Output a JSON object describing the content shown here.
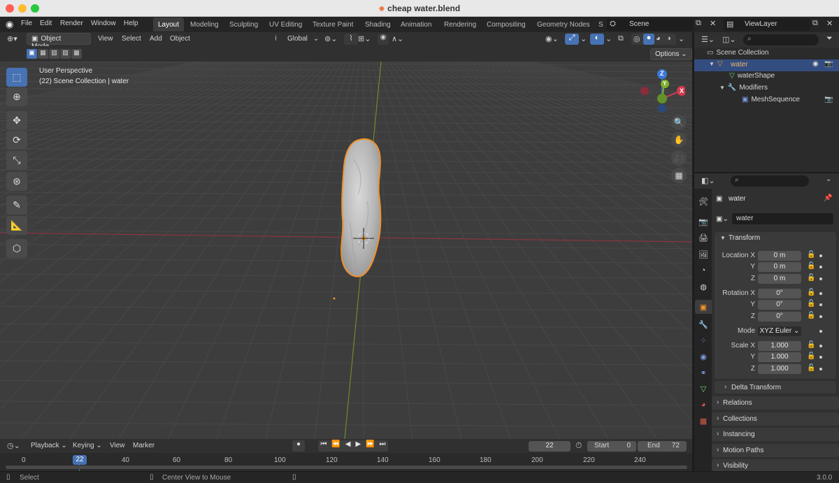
{
  "window": {
    "title": "cheap water.blend",
    "file_icon": "blend-file-icon"
  },
  "menu": [
    "File",
    "Edit",
    "Render",
    "Window",
    "Help"
  ],
  "workspaces": [
    "Layout",
    "Modeling",
    "Sculpting",
    "UV Editing",
    "Texture Paint",
    "Shading",
    "Animation",
    "Rendering",
    "Compositing",
    "Geometry Nodes",
    "S"
  ],
  "active_workspace": "Layout",
  "scene": {
    "label": "Scene",
    "viewlayer": "ViewLayer"
  },
  "viewport_header": {
    "mode": "Object Mode",
    "menus": [
      "View",
      "Select",
      "Add",
      "Object"
    ],
    "orientation": "Global",
    "options_label": "Options"
  },
  "viewport": {
    "overlay_title": "User Perspective",
    "overlay_sub": "(22) Scene Collection | water",
    "gizmo_axes": {
      "z": "Z",
      "y": "Y",
      "x": "X"
    },
    "colors": {
      "x_axis": "#c03a4a",
      "y_axis": "#84b92d",
      "selection": "#f0922c"
    }
  },
  "outliner": {
    "scene_collection": "Scene Collection",
    "items": [
      {
        "label": "water",
        "indent": 1
      },
      {
        "label": "waterShape",
        "indent": 2
      },
      {
        "label": "Modifiers",
        "indent": 2
      },
      {
        "label": "MeshSequence",
        "indent": 3
      }
    ]
  },
  "properties": {
    "object_name": "water",
    "data_name": "water",
    "transform_label": "Transform",
    "location": {
      "label": "Location X",
      "x": "0 m",
      "y": "0 m",
      "z": "0 m"
    },
    "rotation": {
      "label": "Rotation X",
      "x": "0°",
      "y": "0°",
      "z": "0°"
    },
    "mode": {
      "label": "Mode",
      "value": "XYZ Euler"
    },
    "scale": {
      "label": "Scale X",
      "x": "1.000",
      "y": "1.000",
      "z": "1.000"
    },
    "axis_y": "Y",
    "axis_z": "Z",
    "subpanels": [
      "Delta Transform",
      "Relations",
      "Collections",
      "Instancing",
      "Motion Paths",
      "Visibility"
    ]
  },
  "timeline": {
    "menus": [
      "Playback",
      "Keying",
      "View",
      "Marker"
    ],
    "current_frame": "22",
    "start_label": "Start",
    "start": "0",
    "end_label": "End",
    "end": "72",
    "ruler": [
      "0",
      "22",
      "40",
      "60",
      "80",
      "100",
      "120",
      "140",
      "160",
      "180",
      "200",
      "220",
      "240"
    ]
  },
  "status": {
    "left": "Select",
    "middle": "Center View to Mouse",
    "version": "3.0.0"
  }
}
